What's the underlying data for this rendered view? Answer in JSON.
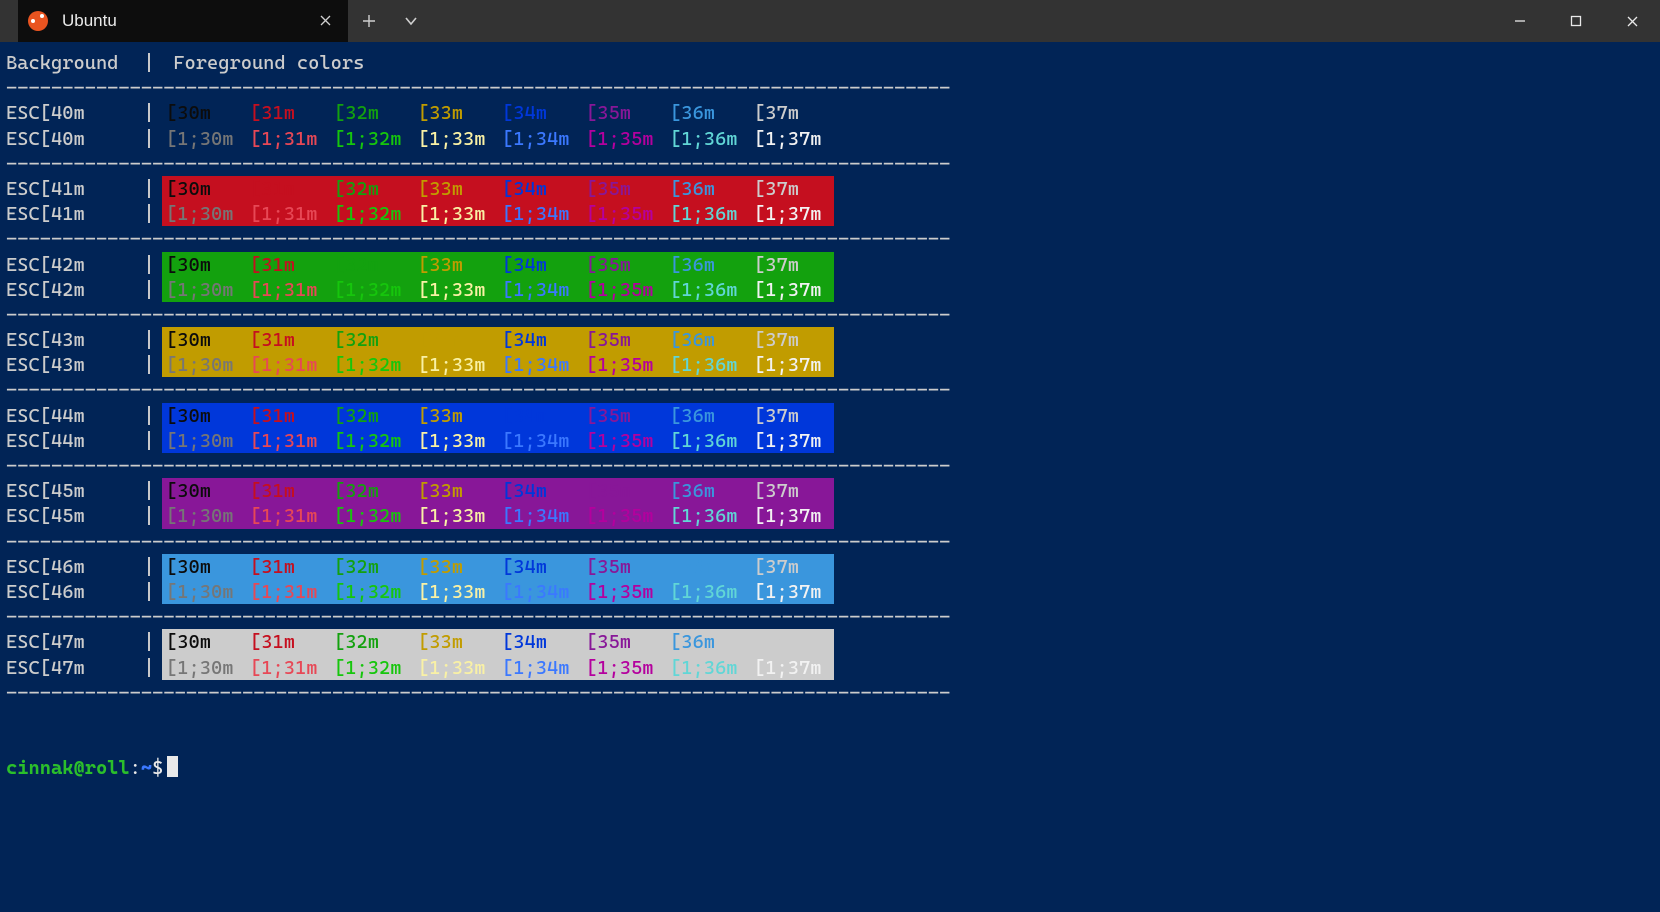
{
  "window": {
    "tab_title": "Ubuntu"
  },
  "header": {
    "col1": "Background",
    "sep": "|",
    "col2": "Foreground colors"
  },
  "hr": "------------------------------------------------------------------------------------",
  "ansi_colors": {
    "normal": {
      "30": "#0c0c0c",
      "31": "#c50f1f",
      "32": "#13a10e",
      "33": "#c19c00",
      "34": "#0037da",
      "35": "#881798",
      "36": "#3a96dd",
      "37": "#cccccc"
    },
    "bright": {
      "30": "#767676",
      "31": "#e74856",
      "32": "#16c60c",
      "33": "#f9f1a5",
      "34": "#3b78ff",
      "35": "#b4009e",
      "36": "#61d6d6",
      "37": "#f2f2f2"
    },
    "bg": {
      "40": "transparent",
      "41": "#c50f1f",
      "42": "#13a10e",
      "43": "#c19c00",
      "44": "#0037da",
      "45": "#881798",
      "46": "#3a96dd",
      "47": "#cccccc"
    }
  },
  "fg_codes_normal": [
    "[30m",
    "[31m",
    "[32m",
    "[33m",
    "[34m",
    "[35m",
    "[36m",
    "[37m"
  ],
  "fg_codes_bright": [
    "[1;30m",
    "[1;31m",
    "[1;32m",
    "[1;33m",
    "[1;34m",
    "[1;35m",
    "[1;36m",
    "[1;37m"
  ],
  "bg_rows": [
    {
      "label": "ESC[40m",
      "bgkey": "40"
    },
    {
      "label": "ESC[41m",
      "bgkey": "41"
    },
    {
      "label": "ESC[42m",
      "bgkey": "42"
    },
    {
      "label": "ESC[43m",
      "bgkey": "43"
    },
    {
      "label": "ESC[44m",
      "bgkey": "44"
    },
    {
      "label": "ESC[45m",
      "bgkey": "45"
    },
    {
      "label": "ESC[46m",
      "bgkey": "46"
    },
    {
      "label": "ESC[47m",
      "bgkey": "47"
    }
  ],
  "prompt": {
    "user_host": "cinnak@roll",
    "colon": ":",
    "path": "~",
    "sigil": "$"
  }
}
